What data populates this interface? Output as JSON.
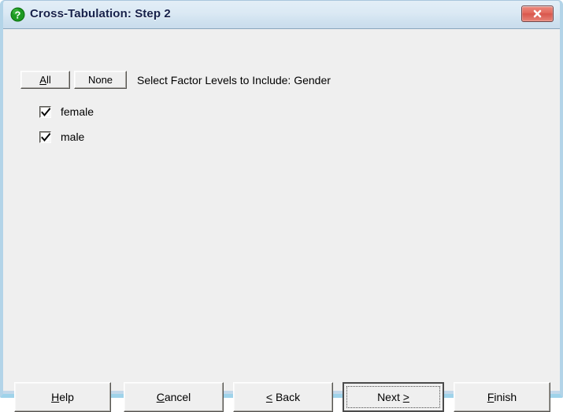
{
  "window": {
    "title": "Cross-Tabulation: Step 2",
    "icon": "question-mark-icon",
    "close_label": "x",
    "colors": {
      "titlebar_top": "#e3eef7",
      "titlebar_bottom": "#c9dcec",
      "title_text": "#16214a",
      "client_background": "#efefef",
      "frame_border": "#b3d4e8",
      "close_button": "#e2685c",
      "icon_green": "#1a8a1a"
    }
  },
  "toolbar": {
    "all_label": "All",
    "all_accel": "A",
    "none_label": "None",
    "none_accel": "N",
    "prompt": "Select Factor Levels to Include: Gender"
  },
  "levels": [
    {
      "label": "female",
      "checked": true
    },
    {
      "label": "male",
      "checked": true
    }
  ],
  "footer": {
    "buttons": [
      {
        "label": "Help",
        "accel": "H",
        "default": false,
        "focused": false
      },
      {
        "label": "Cancel",
        "accel": "C",
        "default": false,
        "focused": false
      },
      {
        "label": "< Back",
        "accel": "<",
        "default": false,
        "focused": false
      },
      {
        "label": "Next >",
        "accel": ">",
        "default": true,
        "focused": true
      },
      {
        "label": "Finish",
        "accel": "F",
        "default": false,
        "focused": false
      }
    ]
  }
}
